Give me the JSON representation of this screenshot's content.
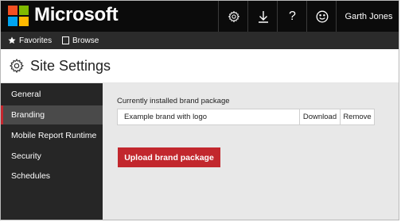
{
  "header": {
    "brand_name": "Microsoft",
    "help_label": "?",
    "user_name": "Garth Jones",
    "icons": [
      "settings-gear",
      "download-arrow",
      "help-question",
      "smiley-feedback"
    ]
  },
  "favbar": {
    "favorites_label": "Favorites",
    "browse_label": "Browse"
  },
  "page": {
    "title": "Site Settings"
  },
  "sidebar": {
    "items": [
      {
        "label": "General",
        "active": false
      },
      {
        "label": "Branding",
        "active": true
      },
      {
        "label": "Mobile Report Runtime",
        "active": false
      },
      {
        "label": "Security",
        "active": false
      },
      {
        "label": "Schedules",
        "active": false
      }
    ]
  },
  "branding": {
    "installed_label": "Currently installed brand package",
    "package_name": "Example brand with logo",
    "download_label": "Download",
    "remove_label": "Remove",
    "upload_label": "Upload brand package"
  },
  "colors": {
    "topbar": "#0b0b0b",
    "favbar": "#2b2b2b",
    "sidebar": "#262626",
    "sidebar_active": "#4a4a4a",
    "accent_red": "#c2272d",
    "main_bg": "#e8e8e8"
  }
}
